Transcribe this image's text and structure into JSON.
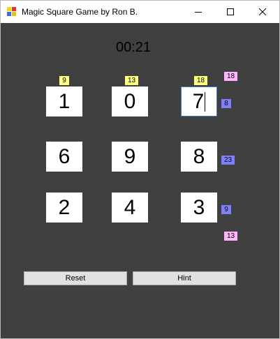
{
  "window": {
    "title": "Magic Square Game by Ron B."
  },
  "timer": "00:21",
  "grid": {
    "rows": [
      [
        "1",
        "0",
        "7"
      ],
      [
        "6",
        "9",
        "8"
      ],
      [
        "2",
        "4",
        "3"
      ]
    ]
  },
  "column_sums": [
    "9",
    "13",
    "18"
  ],
  "row_sums": [
    "8",
    "23",
    "9"
  ],
  "diagonal_sums": {
    "anti_diagonal": "18",
    "main_diagonal": "13"
  },
  "buttons": {
    "reset": "Reset",
    "hint": "Hint"
  },
  "colors": {
    "background": "#404040",
    "column_sum_badge": "#ffff80",
    "diagonal_sum_badge": "#ffb6ff",
    "row_sum_badge": "#8080ff"
  },
  "icons": [
    "app-icon",
    "minimize-icon",
    "maximize-icon",
    "close-icon"
  ]
}
